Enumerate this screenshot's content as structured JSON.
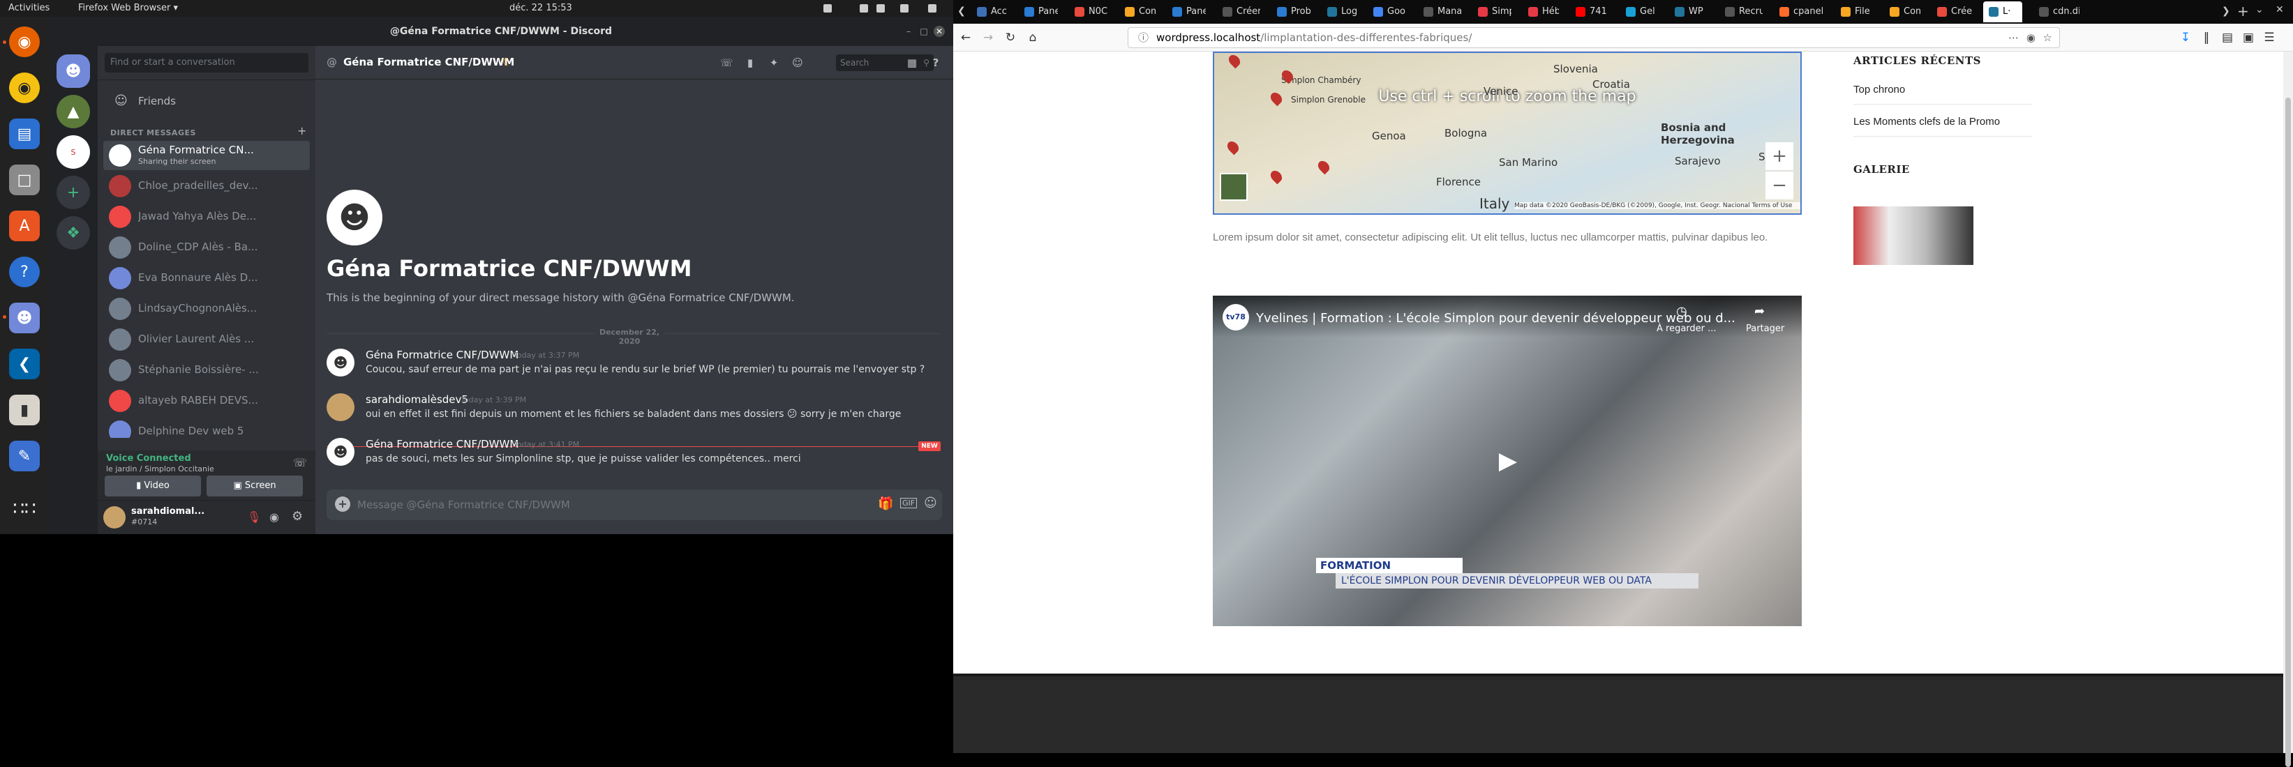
{
  "system": {
    "activities": "Activities",
    "app_menu": "Firefox Web Browser ▾",
    "clock": "déc. 22  15:53"
  },
  "discord": {
    "window_title": "@Géna Formatrice CNF/DWWM - Discord",
    "search_placeholder": "Find or start a conversation",
    "friends": "Friends",
    "dm_header": "DIRECT MESSAGES",
    "dms": [
      {
        "name": "Géna Formatrice CN...",
        "sub": "Sharing their screen",
        "color": "#ffffff"
      },
      {
        "name": "Chloe_pradeilles_dev...",
        "sub": "",
        "color": "#b33a3a"
      },
      {
        "name": "Jawad Yahya Alès De...",
        "sub": "",
        "color": "#f04747"
      },
      {
        "name": "Doline_CDP Alès - Ba...",
        "sub": "",
        "color": "#747f8d"
      },
      {
        "name": "Eva Bonnaure Alès D...",
        "sub": "",
        "color": "#7289da"
      },
      {
        "name": "LindsayChognonAlès...",
        "sub": "",
        "color": "#747f8d"
      },
      {
        "name": "Olivier Laurent Alès ...",
        "sub": "",
        "color": "#747f8d"
      },
      {
        "name": "Stéphanie Boissière- ...",
        "sub": "",
        "color": "#747f8d"
      },
      {
        "name": "altayeb RABEH DEVS...",
        "sub": "",
        "color": "#f04747"
      },
      {
        "name": "Delphine Dev web 5",
        "sub": "",
        "color": "#7289da"
      }
    ],
    "voice": {
      "status": "Voice Connected",
      "channel": "le jardin / Simplon Occitanie",
      "video": "Video",
      "screen": "Screen"
    },
    "user": {
      "name": "sarahdiomal...",
      "tag": "#0714"
    },
    "chat": {
      "header_name": "Géna Formatrice CNF/DWWM",
      "search": "Search",
      "intro_title": "Géna Formatrice CNF/DWWM",
      "intro_text": "This is the beginning of your direct message history with @Géna Formatrice CNF/DWWM.",
      "date_divider": "December 22, 2020",
      "new_badge": "NEW",
      "input_placeholder": "Message @Géna Formatrice CNF/DWWM",
      "messages": [
        {
          "author": "Géna Formatrice CNF/DWWM",
          "time": "Today at 3:37 PM",
          "text": "Coucou, sauf erreur de ma part je n'ai pas reçu le rendu sur le brief WP (le premier) tu pourrais me l'envoyer stp ?"
        },
        {
          "author": "sarahdiomalèsdev5",
          "time": "Today at 3:39 PM",
          "text": "oui en effet il est fini depuis un moment et les fichiers se baladent dans mes dossiers 😕 sorry je m'en charge"
        },
        {
          "author": "Géna Formatrice CNF/DWWM",
          "time": "Today at 3:41 PM",
          "text": "pas de souci, mets les sur Simplonline stp, que je puisse valider les compétences.. merci"
        }
      ]
    }
  },
  "firefox": {
    "tabs": [
      {
        "label": "Accu",
        "color": "#3d6fb4"
      },
      {
        "label": "Pane",
        "color": "#2a7bd1"
      },
      {
        "label": "N0C",
        "color": "#e84a3c"
      },
      {
        "label": "Com",
        "color": "#f6a623"
      },
      {
        "label": "Pane",
        "color": "#2a7bd1"
      },
      {
        "label": "Créer un",
        "color": "#555555"
      },
      {
        "label": "Prob",
        "color": "#2a7bd1"
      },
      {
        "label": "Log",
        "color": "#21759b"
      },
      {
        "label": "Goo",
        "color": "#4285f4"
      },
      {
        "label": "Manage",
        "color": "#555555"
      },
      {
        "label": "Simp",
        "color": "#e63946"
      },
      {
        "label": "Héb",
        "color": "#e63946"
      },
      {
        "label": "741",
        "color": "#ff0000"
      },
      {
        "label": "Gel",
        "color": "#1aa0d8"
      },
      {
        "label": "WP",
        "color": "#21759b"
      },
      {
        "label": "Recruta",
        "color": "#555555"
      },
      {
        "label": "cpanel",
        "color": "#ff6c2c"
      },
      {
        "label": "File",
        "color": "#f6a623"
      },
      {
        "label": "Com",
        "color": "#f6a623"
      },
      {
        "label": "Crée",
        "color": "#e84a3c"
      },
      {
        "label": "L·",
        "color": "#21759b"
      },
      {
        "label": "cdn.disc",
        "color": "#555555"
      }
    ],
    "url_domain": "wordpress.localhost",
    "url_path": "/limplantation-des-differentes-fabriques/",
    "page": {
      "map_overlay": "Use ctrl + scroll to zoom the map",
      "map_labels": [
        "Slovenia",
        "Croatia",
        "Venice",
        "Genoa",
        "Bologna",
        "San Marino",
        "Florence",
        "Bosnia and Herzegovina",
        "Sarajevo",
        "Italy",
        "Simplon Chambéry",
        "Simplon Grenoble",
        "Serb"
      ],
      "map_credits": "Map data ©2020 GeoBasis-DE/BKG (©2009), Google, Inst. Geogr. Nacional   Terms of Use",
      "lorem": "Lorem ipsum dolor sit amet, consectetur adipiscing elit. Ut elit tellus, luctus nec ullamcorper mattis, pulvinar dapibus leo.",
      "video_title": "Yvelines | Formation : L'école Simplon pour devenir développeur web ou d...",
      "video_watch_later": "À regarder ...",
      "video_share": "Partager",
      "video_caption_1": "FORMATION",
      "video_caption_2": "L'ÉCOLE SIMPLON POUR DEVENIR DÉVELOPPEUR WEB OU DATA",
      "video_channel": "tv78"
    },
    "sidebar": {
      "recent_title": "ARTICLES RÉCENTS",
      "recent": [
        "Top chrono",
        "Les Moments clefs de la Promo"
      ],
      "gallery_title": "GALERIE"
    }
  }
}
